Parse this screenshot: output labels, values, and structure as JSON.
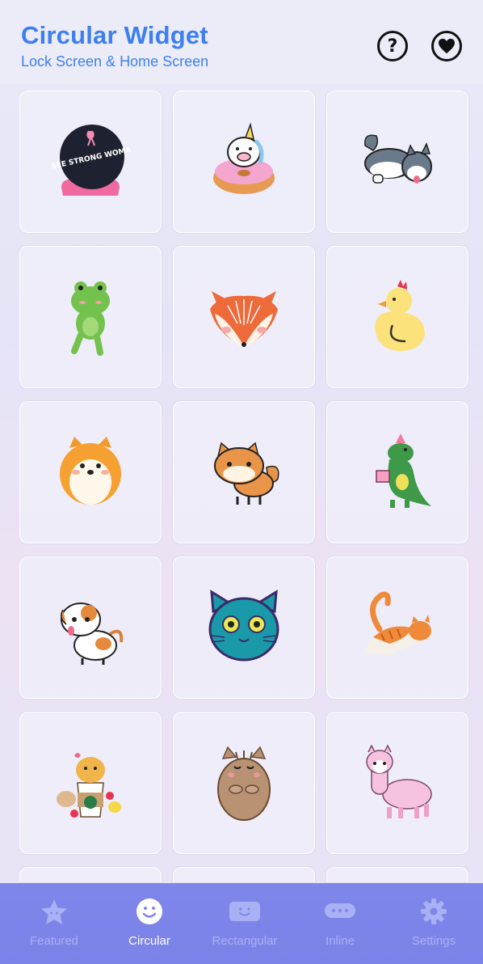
{
  "header": {
    "title": "Circular Widget",
    "subtitle": "Lock Screen & Home Screen",
    "help_icon": "question-circle-icon",
    "favorite_icon": "heart-circle-icon",
    "help_glyph": "?"
  },
  "widgets": [
    {
      "icon": "crystal-ball-sticker",
      "text": "I SEE STRONG WOMAN"
    },
    {
      "icon": "unicorn-pig-donut-sticker"
    },
    {
      "icon": "husky-dog-sticker"
    },
    {
      "icon": "frog-sticker"
    },
    {
      "icon": "fox-face-sticker"
    },
    {
      "icon": "yellow-duck-sticker"
    },
    {
      "icon": "pomeranian-dog-sticker"
    },
    {
      "icon": "shiba-inu-sticker"
    },
    {
      "icon": "dinosaur-gift-sticker"
    },
    {
      "icon": "puppy-sticker"
    },
    {
      "icon": "blue-cat-face-sticker"
    },
    {
      "icon": "orange-tabby-cat-sticker"
    },
    {
      "icon": "hamsters-coffee-sticker"
    },
    {
      "icon": "brown-cat-sticker"
    },
    {
      "icon": "pink-llama-sticker"
    }
  ],
  "tabs": [
    {
      "label": "Featured",
      "icon": "star-face-icon",
      "active": false
    },
    {
      "label": "Circular",
      "icon": "smiley-circle-icon",
      "active": true
    },
    {
      "label": "Rectangular",
      "icon": "rectangle-smile-icon",
      "active": false
    },
    {
      "label": "Inline",
      "icon": "inline-dots-icon",
      "active": false
    },
    {
      "label": "Settings",
      "icon": "gear-icon",
      "active": false
    }
  ]
}
